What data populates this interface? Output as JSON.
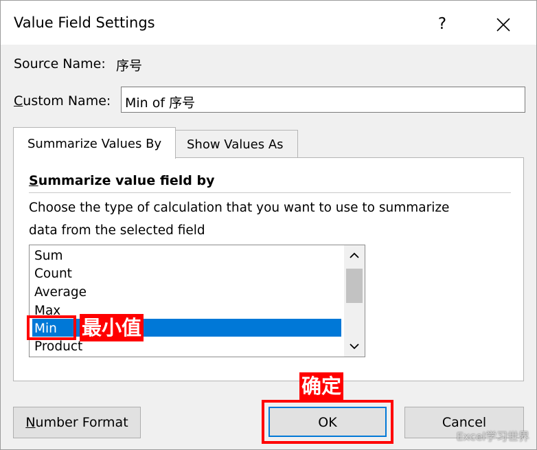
{
  "dialog": {
    "title": "Value Field Settings",
    "help_label": "?",
    "source_name_label": "Source Name:",
    "source_name_value": "序号",
    "custom_name_label_u": "C",
    "custom_name_label_rest": "ustom Name:",
    "custom_name_value": "Min of 序号"
  },
  "tabs": [
    {
      "label": "Summarize Values By",
      "active": true
    },
    {
      "label": "Show Values As",
      "active": false
    }
  ],
  "panel": {
    "section_title_u": "S",
    "section_title_rest": "ummarize value field by",
    "description_line1": "Choose the type of calculation that you want to use to summarize",
    "description_line2": "data from the selected field",
    "list_items": [
      "Sum",
      "Count",
      "Average",
      "Max",
      "Min",
      "Product"
    ],
    "selected_item": "Min"
  },
  "buttons": {
    "number_format_u": "N",
    "number_format_rest": "umber Format",
    "ok": "OK",
    "cancel": "Cancel"
  },
  "annotations": {
    "min_label": "最小值",
    "ok_label": "确定"
  },
  "watermark": "Excel学习世界",
  "colors": {
    "selection": "#0078d7",
    "highlight": "#ff0000"
  }
}
